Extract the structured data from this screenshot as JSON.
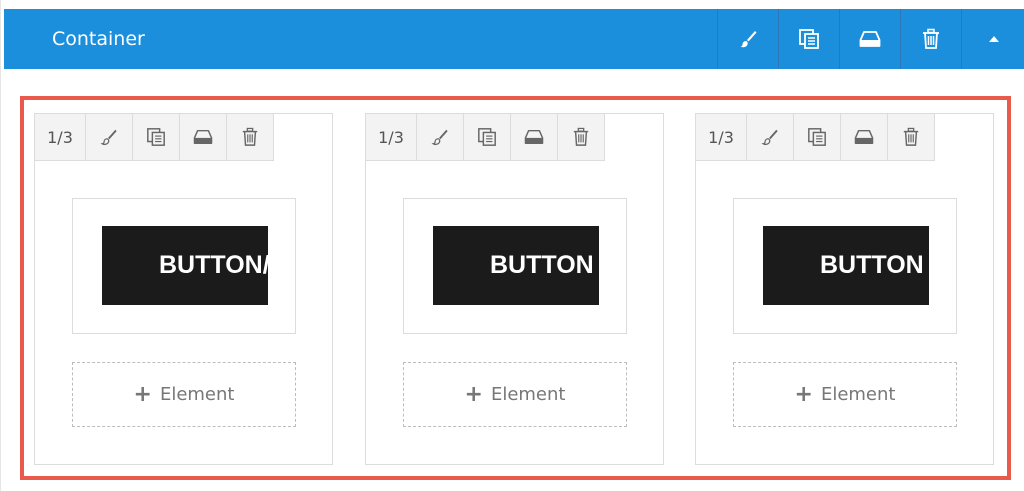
{
  "header": {
    "title": "Container",
    "background": "#1b8fdc",
    "tools": [
      "brush-icon",
      "duplicate-icon",
      "save-icon",
      "trash-icon",
      "collapse-up-icon"
    ]
  },
  "selection_color": "#ea5a4b",
  "columns": [
    {
      "size_label": "1/3",
      "button_text": "BUTTON/",
      "add_element_label": "Element"
    },
    {
      "size_label": "1/3",
      "button_text": "BUTTON",
      "add_element_label": "Element"
    },
    {
      "size_label": "1/3",
      "button_text": "BUTTON",
      "add_element_label": "Element"
    }
  ]
}
